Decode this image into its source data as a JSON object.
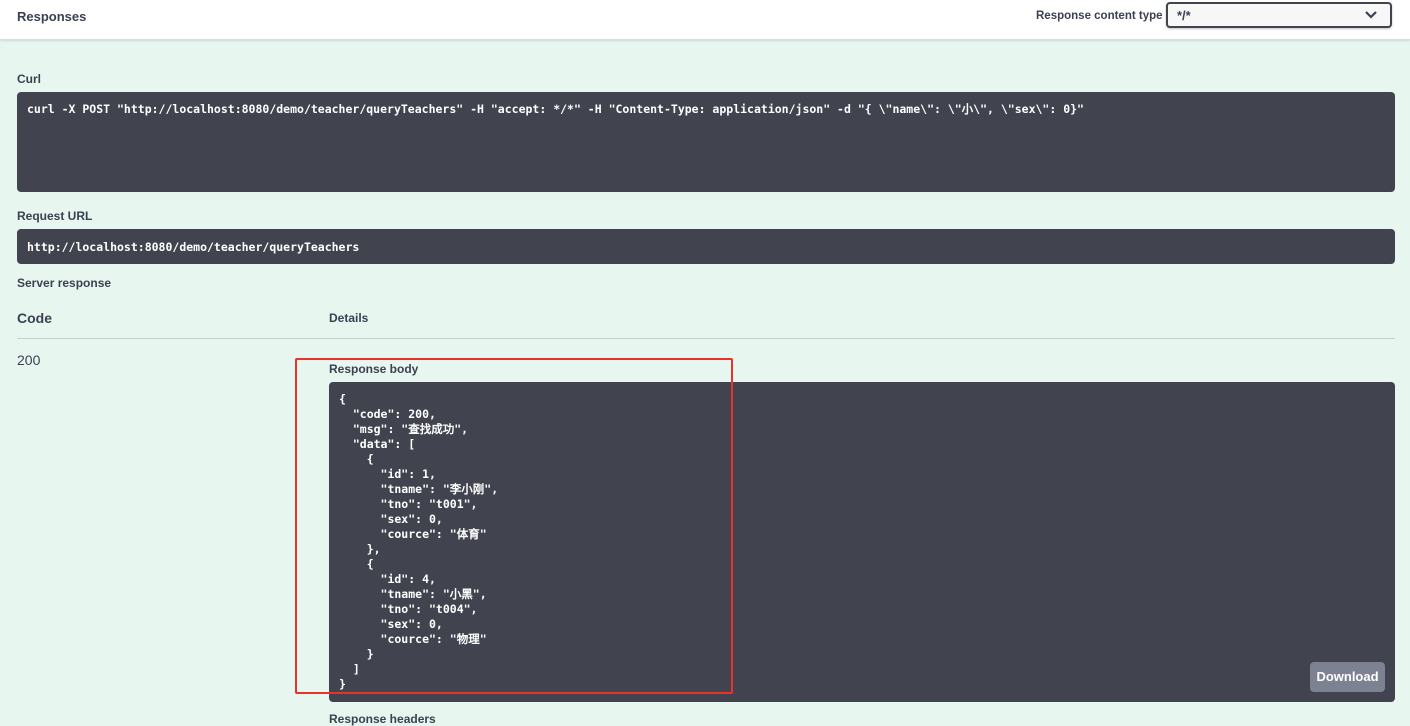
{
  "header": {
    "title": "Responses",
    "content_type_label": "Response content type",
    "content_type_value": "*/*"
  },
  "curl": {
    "label": "Curl",
    "command": "curl -X POST \"http://localhost:8080/demo/teacher/queryTeachers\" -H \"accept: */*\" -H \"Content-Type: application/json\" -d \"{ \\\"name\\\": \\\"小\\\", \\\"sex\\\": 0}\""
  },
  "request_url": {
    "label": "Request URL",
    "value": "http://localhost:8080/demo/teacher/queryTeachers"
  },
  "server_response": {
    "label": "Server response",
    "col_code": "Code",
    "col_details": "Details",
    "status_code": "200",
    "body_label": "Response body",
    "body_lines": [
      "{",
      "  \"code\": 200,",
      "  \"msg\": \"查找成功\",",
      "  \"data\": [",
      "    {",
      "      \"id\": 1,",
      "      \"tname\": \"李小刚\",",
      "      \"tno\": \"t001\",",
      "      \"sex\": 0,",
      "      \"cource\": \"体育\"",
      "    },",
      "    {",
      "      \"id\": 4,",
      "      \"tname\": \"小黑\",",
      "      \"tno\": \"t004\",",
      "      \"sex\": 0,",
      "      \"cource\": \"物理\"",
      "    }",
      "  ]",
      "}"
    ],
    "download_label": "Download",
    "headers_label": "Response headers"
  },
  "colors": {
    "background": "#e8f6f0",
    "code_bg": "#41444e",
    "highlight": "#e8322a",
    "download_bg": "#7d8293"
  }
}
